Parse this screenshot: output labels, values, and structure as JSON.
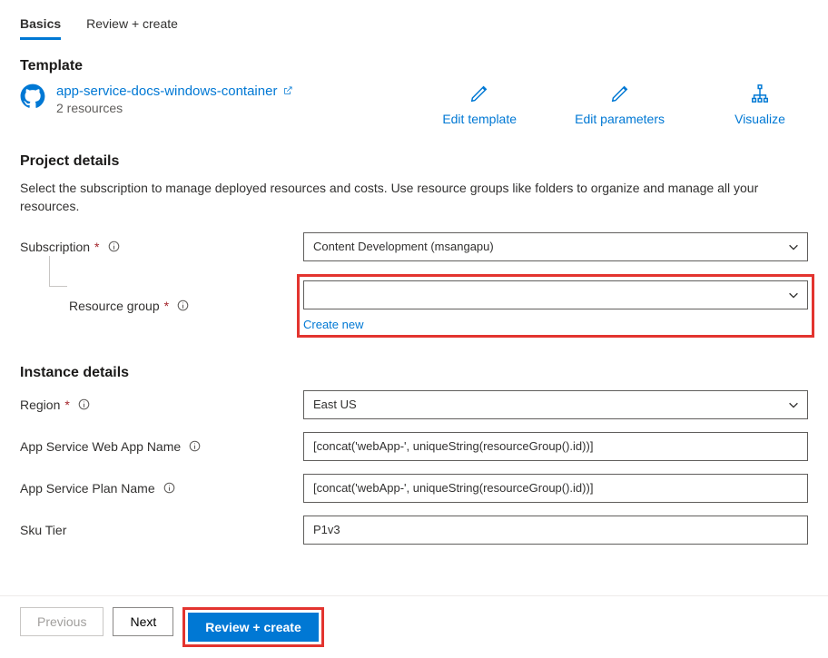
{
  "tabs": {
    "basics": "Basics",
    "review_create": "Review + create"
  },
  "template_section": {
    "heading": "Template",
    "link_text": "app-service-docs-windows-container",
    "resources_count": "2 resources"
  },
  "template_actions": {
    "edit_template": "Edit template",
    "edit_parameters": "Edit parameters",
    "visualize": "Visualize"
  },
  "project_details": {
    "heading": "Project details",
    "description": "Select the subscription to manage deployed resources and costs. Use resource groups like folders to organize and manage all your resources.",
    "subscription_label": "Subscription",
    "subscription_value": "Content Development (msangapu)",
    "resource_group_label": "Resource group",
    "resource_group_value": "",
    "create_new": "Create new"
  },
  "instance_details": {
    "heading": "Instance details",
    "region_label": "Region",
    "region_value": "East US",
    "web_app_name_label": "App Service Web App Name",
    "web_app_name_value": "[concat('webApp-', uniqueString(resourceGroup().id))]",
    "plan_name_label": "App Service Plan Name",
    "plan_name_value": "[concat('webApp-', uniqueString(resourceGroup().id))]",
    "sku_tier_label": "Sku Tier",
    "sku_tier_value": "P1v3"
  },
  "footer": {
    "previous": "Previous",
    "next": "Next",
    "review_create": "Review + create"
  }
}
